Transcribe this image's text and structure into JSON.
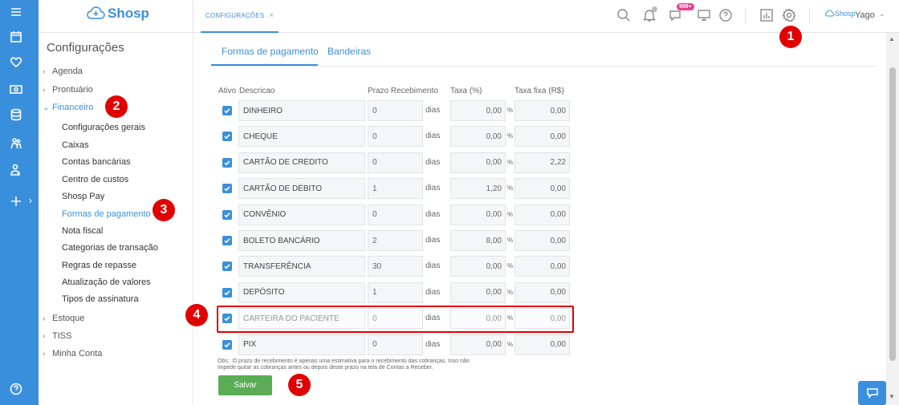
{
  "app": {
    "brand": "Shosp",
    "mini_brand": "Shosp"
  },
  "topbar": {
    "tab_label": "CONFIGURAÇÕES",
    "tab_close": "×",
    "notifications_badge": "999+",
    "user_name": "Yago"
  },
  "sidebar": {
    "title": "Configurações",
    "sections": [
      {
        "label": "Agenda"
      },
      {
        "label": "Prontuário"
      },
      {
        "label": "Financeiro"
      },
      {
        "label": "Estoque"
      },
      {
        "label": "TISS"
      },
      {
        "label": "Minha Conta"
      }
    ],
    "financeiro_items": [
      {
        "label": "Configurações gerais"
      },
      {
        "label": "Caixas"
      },
      {
        "label": "Contas bancárias"
      },
      {
        "label": "Centro de custos"
      },
      {
        "label": "Shosp Pay"
      },
      {
        "label": "Formas de pagamento"
      },
      {
        "label": "Nota fiscal"
      },
      {
        "label": "Categorias de transação"
      },
      {
        "label": "Regras de repasse"
      },
      {
        "label": "Atualização de valores"
      },
      {
        "label": "Tipos de assinatura"
      }
    ]
  },
  "main": {
    "tabs": [
      {
        "label": "Formas de pagamento"
      },
      {
        "label": "Bandeiras"
      }
    ],
    "headers": {
      "ativo": "Ativo",
      "descricao": "Descricao",
      "prazo": "Prazo Recebimento",
      "taxa": "Taxa (%)",
      "taxa_fixa": "Taxa fixa (R$)"
    },
    "unit_dias": "dias",
    "unit_pct": "%",
    "rows": [
      {
        "active": true,
        "descricao": "DINHEIRO",
        "prazo": "0",
        "taxa": "0,00",
        "taxa_fixa": "0,00"
      },
      {
        "active": true,
        "descricao": "CHEQUE",
        "prazo": "0",
        "taxa": "0,00",
        "taxa_fixa": "0,00"
      },
      {
        "active": true,
        "descricao": "CARTÃO DE CREDITO",
        "prazo": "0",
        "taxa": "0,00",
        "taxa_fixa": "2,22"
      },
      {
        "active": true,
        "descricao": "CARTÃO DE DÉBITO",
        "prazo": "1",
        "taxa": "1,20",
        "taxa_fixa": "0,00"
      },
      {
        "active": true,
        "descricao": "CONVÊNIO",
        "prazo": "0",
        "taxa": "0,00",
        "taxa_fixa": "0,00"
      },
      {
        "active": true,
        "descricao": "BOLETO BANCÁRIO",
        "prazo": "2",
        "taxa": "8,00",
        "taxa_fixa": "0,00"
      },
      {
        "active": true,
        "descricao": "TRANSFERÊNCIA",
        "prazo": "30",
        "taxa": "0,00",
        "taxa_fixa": "0,00"
      },
      {
        "active": true,
        "descricao": "DEPÓSITO",
        "prazo": "1",
        "taxa": "0,00",
        "taxa_fixa": "0,00"
      },
      {
        "active": true,
        "descricao": "CARTEIRA DO PACIENTE",
        "prazo": "0",
        "taxa": "0,00",
        "taxa_fixa": "0,00"
      },
      {
        "active": true,
        "descricao": "PIX",
        "prazo": "0",
        "taxa": "0,00",
        "taxa_fixa": "0,00"
      }
    ],
    "note": "Obs.: O prazo de recebimento é apenas uma estimativa para o recebimento das cobranças. Isso não impede quitar as cobranças antes ou depois deste prazo na tela de Contas a Receber.",
    "save_label": "Salvar"
  },
  "annotations": {
    "markers": [
      "1",
      "2",
      "3",
      "4",
      "5"
    ],
    "color": "#e00000"
  },
  "colors": {
    "brand": "#3a8fdc",
    "save": "#5aac55",
    "badge": "#e83e8c"
  }
}
